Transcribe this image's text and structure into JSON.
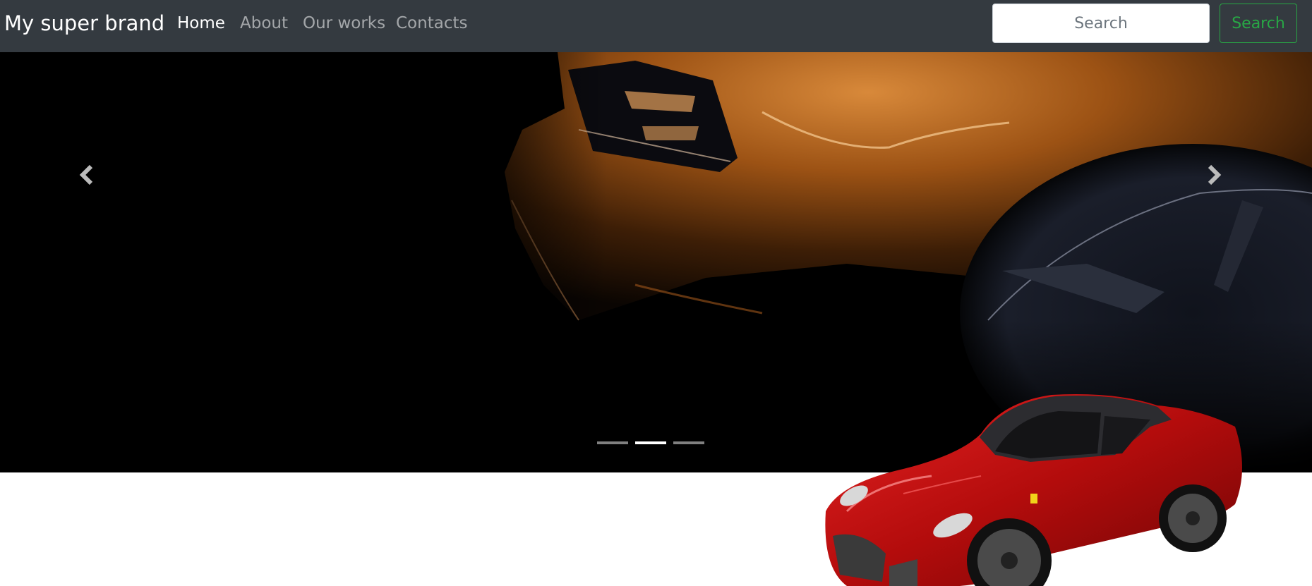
{
  "navbar": {
    "brand": "My super brand",
    "links": [
      {
        "label": "Home",
        "active": true
      },
      {
        "label": "About",
        "active": false
      },
      {
        "label": "Our works",
        "active": false
      },
      {
        "label": "Contacts",
        "active": false
      }
    ],
    "search": {
      "placeholder": "Search",
      "button_label": "Search"
    }
  },
  "carousel": {
    "slide_count": 3,
    "active_slide": 2,
    "prev_icon": "chevron-left-icon",
    "next_icon": "chevron-right-icon"
  },
  "colors": {
    "navbar_bg": "#343a40",
    "success": "#28a745",
    "car_red": "#c00d0d",
    "car_orange": "#b8620f"
  }
}
